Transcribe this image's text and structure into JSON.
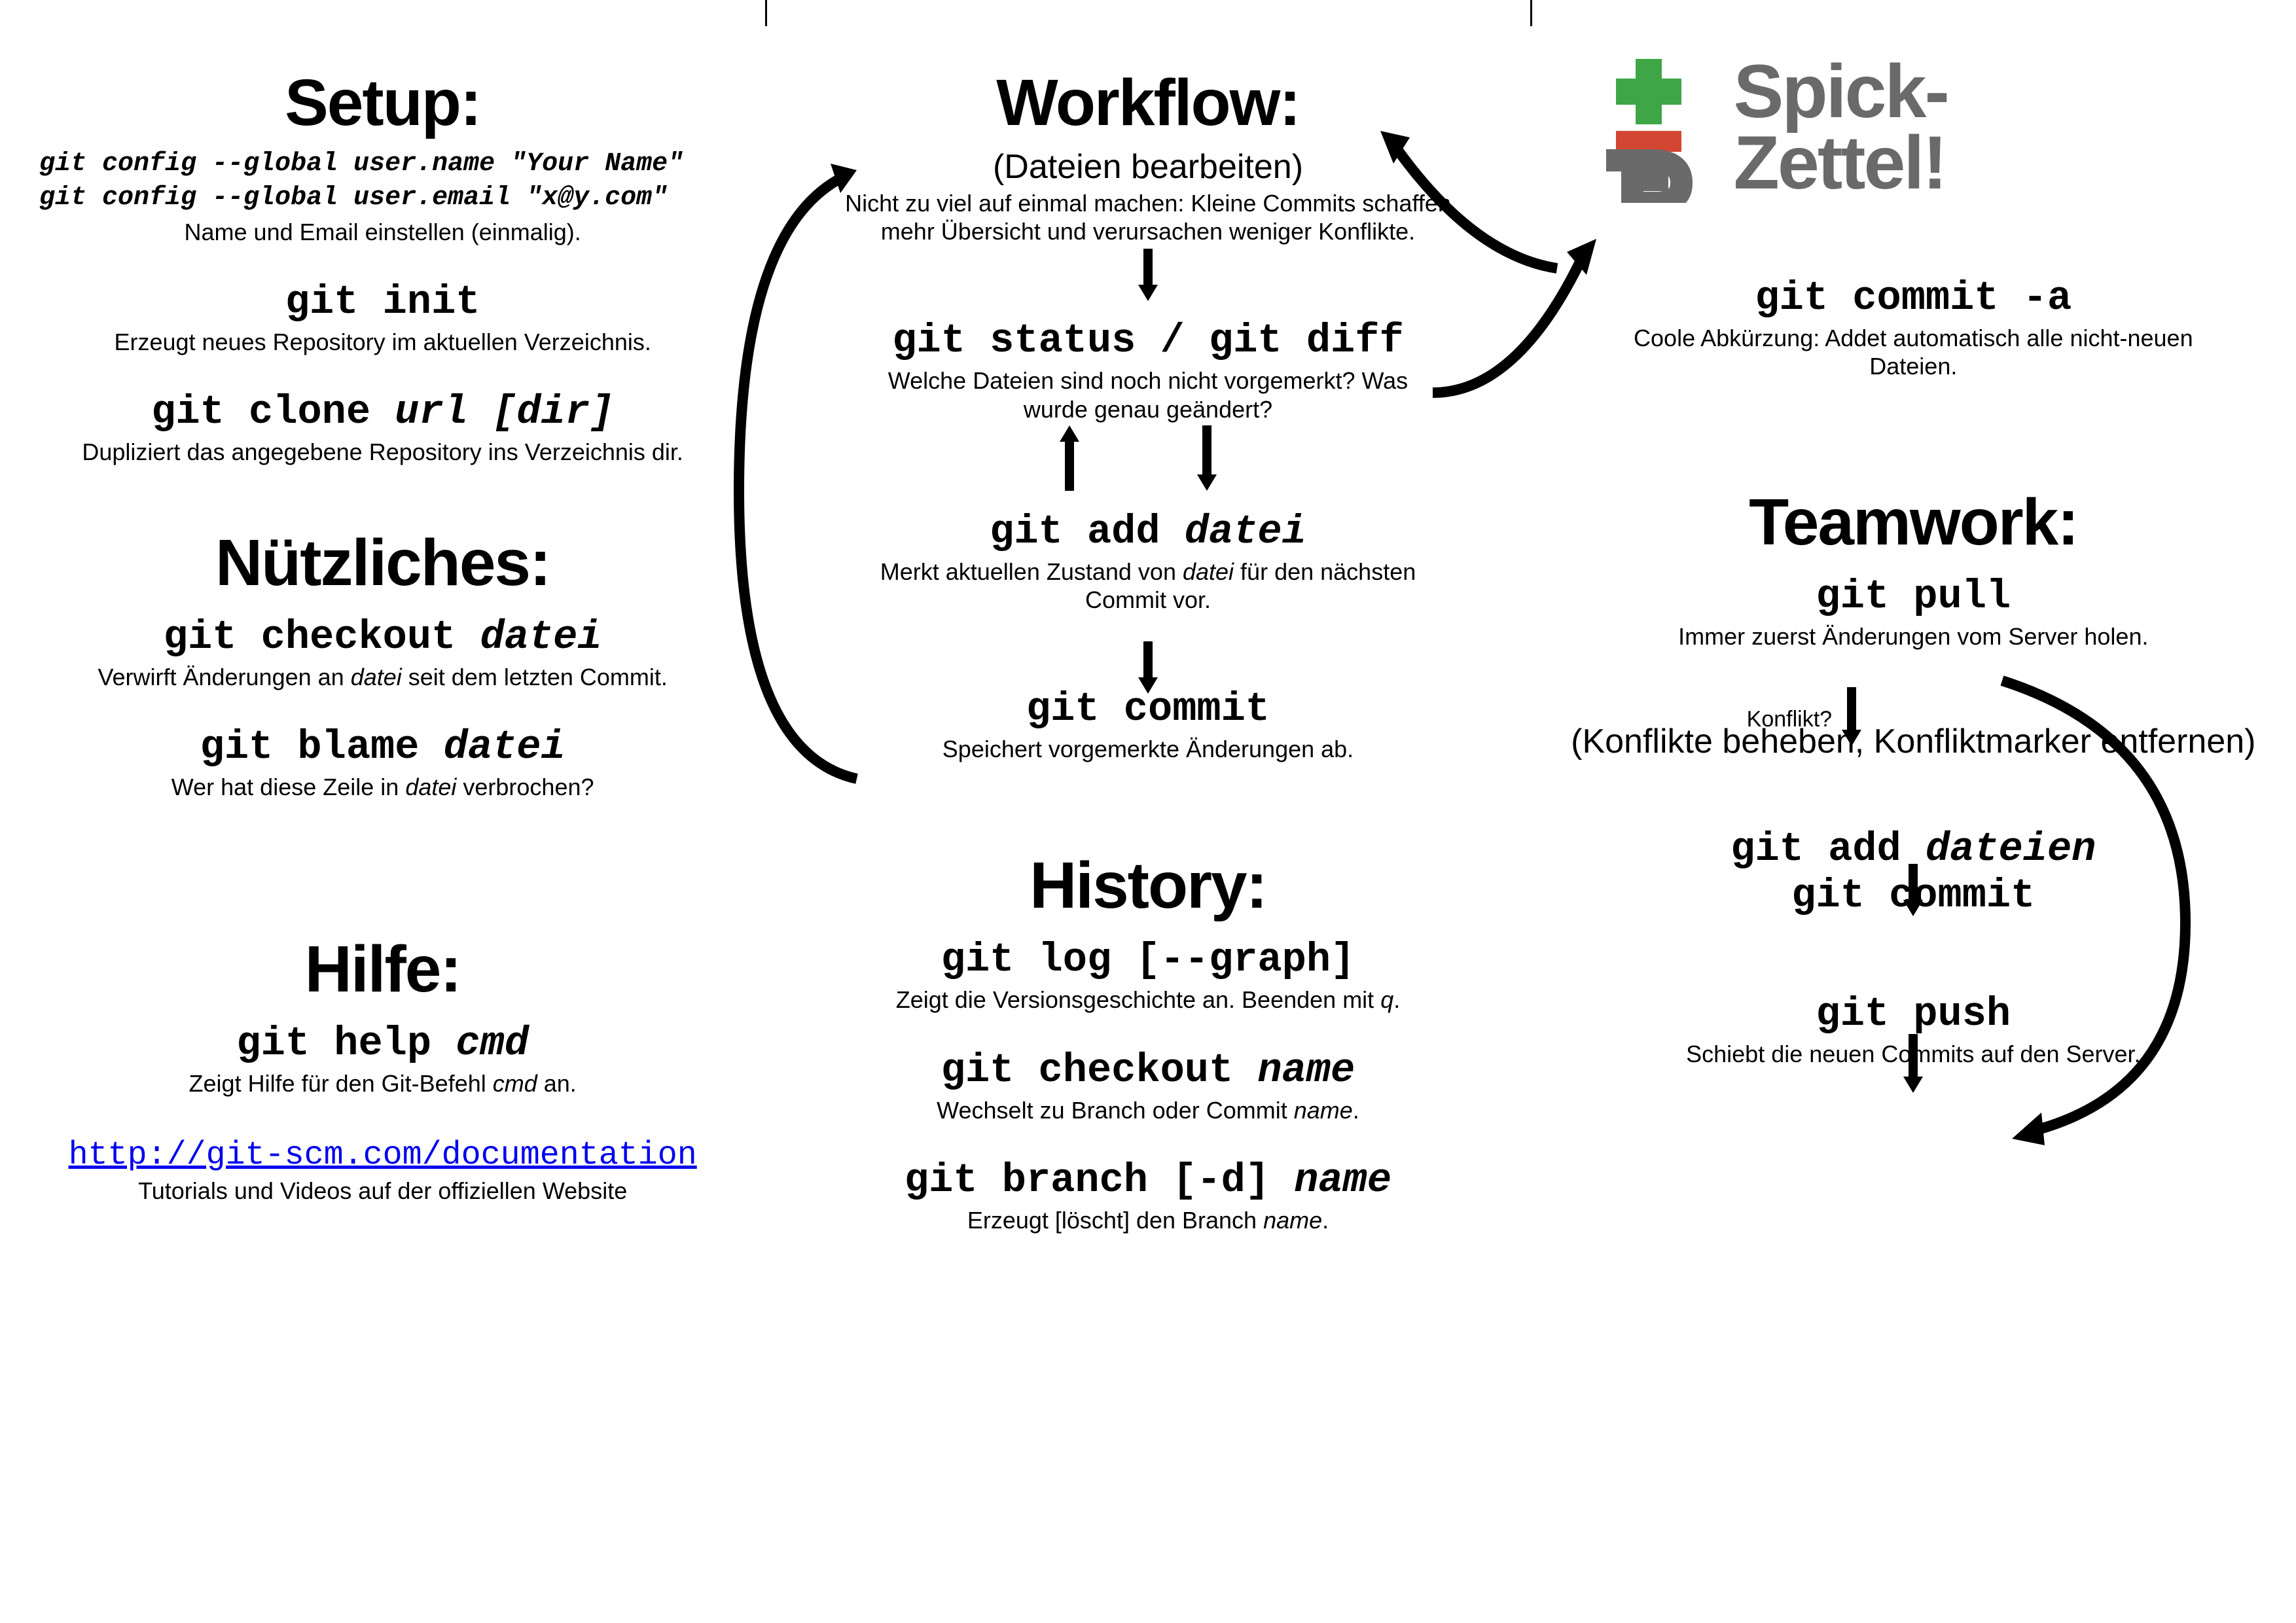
{
  "title_logo": {
    "line1": "Spick-",
    "line2": "Zettel!"
  },
  "fold_marks": [
    1169,
    2338
  ],
  "col1": {
    "setup": {
      "heading": "Setup:",
      "config_name": "git config --global user.name \"Your Name\"",
      "config_email": "git config --global user.email \"x@y.com\"",
      "config_desc": "Name und Email einstellen (einmalig).",
      "init_cmd": "git init",
      "init_desc": "Erzeugt neues Repository im aktuellen Verzeichnis.",
      "clone_cmd_a": "git clone ",
      "clone_cmd_b": "url [dir]",
      "clone_desc": "Dupliziert das angegebene Repository ins Verzeichnis dir."
    },
    "useful": {
      "heading": "Nützliches:",
      "checkout_cmd_a": "git checkout ",
      "checkout_cmd_b": "datei",
      "checkout_desc_a": "Verwirft Änderungen an ",
      "checkout_desc_b": "datei",
      "checkout_desc_c": " seit dem letzten Commit.",
      "blame_cmd_a": "git blame ",
      "blame_cmd_b": "datei",
      "blame_desc_a": "Wer hat diese Zeile in ",
      "blame_desc_b": "datei",
      "blame_desc_c": " verbrochen?"
    },
    "help": {
      "heading": "Hilfe:",
      "help_cmd_a": "git help ",
      "help_cmd_b": "cmd",
      "help_desc_a": "Zeigt Hilfe für den Git-Befehl ",
      "help_desc_b": "cmd",
      "help_desc_c": " an.",
      "link": "http://git-scm.com/documentation",
      "link_desc": "Tutorials und Videos auf der offiziellen Website"
    }
  },
  "col2": {
    "workflow": {
      "heading": "Workflow:",
      "edit_note": "(Dateien bearbeiten)",
      "edit_desc": "Nicht zu viel auf einmal machen: Kleine Commits schaffen mehr Übersicht und verursachen weniger Konflikte.",
      "status_cmd": "git status / git diff",
      "status_desc": "Welche Dateien sind noch nicht vorgemerkt? Was wurde genau geändert?",
      "add_cmd_a": "git add ",
      "add_cmd_b": "datei",
      "add_desc_a": "Merkt aktuellen Zustand von ",
      "add_desc_b": "datei",
      "add_desc_c": " für den nächsten Commit vor.",
      "commit_cmd": "git commit",
      "commit_desc": "Speichert vorgemerkte Änderungen ab."
    },
    "history": {
      "heading": "History:",
      "log_cmd": "git log [--graph]",
      "log_desc_a": "Zeigt die Versionsgeschichte an. Beenden mit ",
      "log_desc_b": "q",
      "log_desc_c": ".",
      "checkout_cmd_a": "git checkout ",
      "checkout_cmd_b": "name",
      "checkout_desc_a": "Wechselt zu Branch oder Commit ",
      "checkout_desc_b": "name",
      "checkout_desc_c": ".",
      "branch_cmd_a": "git branch [-d] ",
      "branch_cmd_b": "name",
      "branch_desc_a": "Erzeugt [löscht] den Branch ",
      "branch_desc_b": "name",
      "branch_desc_c": "."
    }
  },
  "col3": {
    "commit_a": {
      "cmd": "git commit -a",
      "desc": "Coole Abkürzung: Addet automatisch alle nicht-neuen Dateien."
    },
    "teamwork": {
      "heading": "Teamwork:",
      "pull_cmd": "git pull",
      "pull_desc": "Immer zuerst Änderungen vom Server holen.",
      "konflikt_label": "Konflikt?",
      "resolve_note": "(Konflikte beheben, Konfliktmarker entfernen)",
      "add_cmd_a": "git add ",
      "add_cmd_b": "dateien",
      "commit_cmd": "git commit",
      "push_cmd": "git push",
      "push_desc": "Schiebt die neuen Commits auf den Server."
    }
  }
}
